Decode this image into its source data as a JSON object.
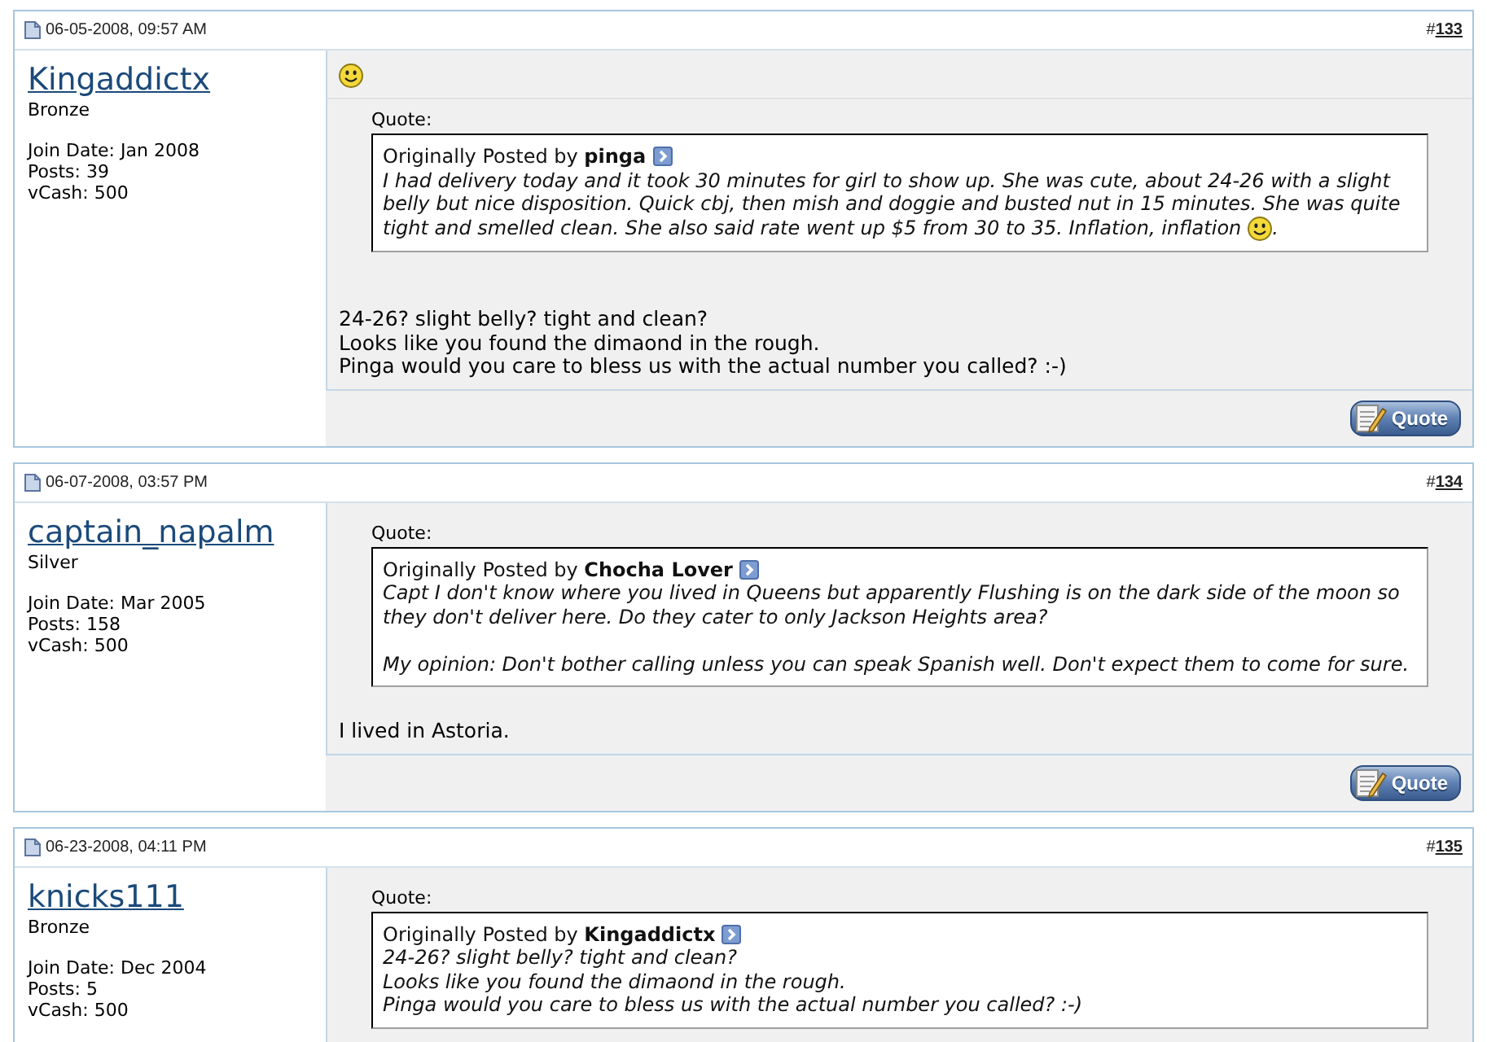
{
  "posts": [
    {
      "date": "06-05-2008, 09:57 AM",
      "number_prefix": "#",
      "number": "133",
      "username": "Kingaddictx",
      "rank": "Bronze",
      "user_stats": [
        "Join Date: Jan 2008",
        "Posts: 39",
        "vCash: 500"
      ],
      "title_smiley": true,
      "quote": {
        "label": "Quote:",
        "attribution": "Originally Posted by **pinga**",
        "paragraphs": [
          {
            "lines": [
              {
                "text": "I had delivery today and it took 30 minutes for girl to show up. She was cute, about 24-26 with a slight",
                "smiley": false
              },
              {
                "text": "belly but nice disposition. Quick cbj, then mish and doggie and busted nut in 15 minutes. She was quite",
                "smiley": false
              },
              {
                "text": "tight and smelled clean. She also said rate went up $5 from 30 to 35. Inflation, inflation",
                "smiley": true,
                "text_after": "."
              }
            ]
          }
        ]
      },
      "message": {
        "leading_blank_line": true,
        "lines": [
          "24-26? slight belly? tight and clean?",
          "Looks like you found the dimaond in the rough.",
          "Pinga would you care to bless us with the actual number you called? :-)"
        ]
      },
      "quote_button": "Quote"
    },
    {
      "date": "06-07-2008, 03:57 PM",
      "number_prefix": "#",
      "number": "134",
      "username": "captain_napalm",
      "rank": "Silver",
      "user_stats": [
        "Join Date: Mar 2005",
        "Posts: 158",
        "vCash: 500"
      ],
      "title_smiley": false,
      "quote": {
        "label": "Quote:",
        "attribution": "Originally Posted by **Chocha Lover**",
        "paragraphs": [
          {
            "lines": [
              {
                "text": "Capt I don't know where you lived in Queens but apparently Flushing is on the dark side of the moon so",
                "smiley": false
              },
              {
                "text": "they don't deliver here. Do they cater to only Jackson Heights area?",
                "smiley": false
              }
            ]
          },
          {
            "lines": [
              {
                "text": "My opinion: Don't bother calling unless you can speak Spanish well. Don't expect them to come for sure.",
                "smiley": false
              }
            ]
          }
        ]
      },
      "message": {
        "leading_blank_line": false,
        "lines": [
          "I lived in Astoria."
        ]
      },
      "quote_button": "Quote"
    },
    {
      "date": "06-23-2008, 04:11 PM",
      "number_prefix": "#",
      "number": "135",
      "username": "knicks111",
      "rank": "Bronze",
      "user_stats": [
        "Join Date: Dec 2004",
        "Posts: 5",
        "vCash: 500"
      ],
      "title_smiley": false,
      "quote": {
        "label": "Quote:",
        "attribution": "Originally Posted by **Kingaddictx**",
        "paragraphs": [
          {
            "lines": [
              {
                "text": "24-26? slight belly? tight and clean?",
                "smiley": false
              },
              {
                "text": "Looks like you found the dimaond in the rough.",
                "smiley": false
              },
              {
                "text": "Pinga would you care to bless us with the actual number you called? :-)",
                "smiley": false
              }
            ]
          }
        ]
      }
    }
  ]
}
